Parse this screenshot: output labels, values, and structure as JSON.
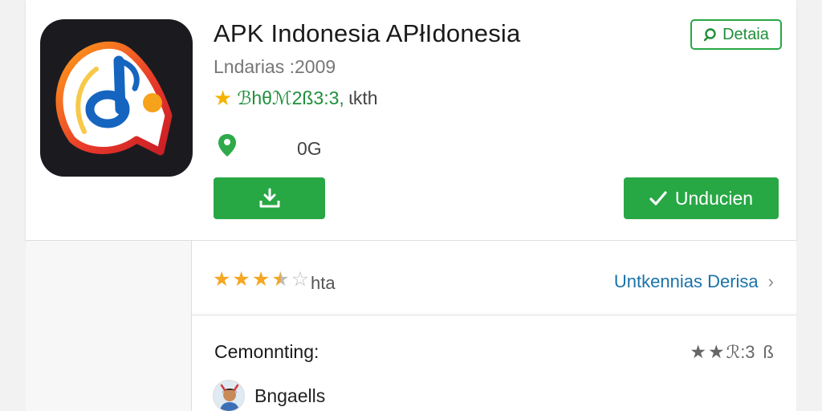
{
  "app": {
    "title": "APK Indonesia APłIdonesia",
    "developer": "Lndarias :2009",
    "rating_star": "★",
    "rating_text": "ℬhθℳ2ß3:3,",
    "rating_suffix": "ɩkth",
    "size_text": "0G"
  },
  "actions": {
    "details_label": "Detaia",
    "download_label": "Unducien"
  },
  "ratings": {
    "stars_filled": 3.5,
    "stars_total": 5,
    "label": "hta",
    "reviews_link": "Untkennias Derisa",
    "chevron": "›"
  },
  "comment": {
    "heading": "Cemonnting:",
    "rating_text": "ℛ:3",
    "rating_extra": "ß",
    "user_name": "Bngaells"
  },
  "colors": {
    "accent_green": "#28a745",
    "star_gold": "#f5a623",
    "link_blue": "#1a73a8"
  },
  "icons": {
    "app_logo": "music-note-logo-icon",
    "details": "search-icon",
    "location": "location-pin-icon",
    "install": "download-tray-icon",
    "download": "checkmark-icon",
    "chevron": "chevron-right-icon"
  }
}
